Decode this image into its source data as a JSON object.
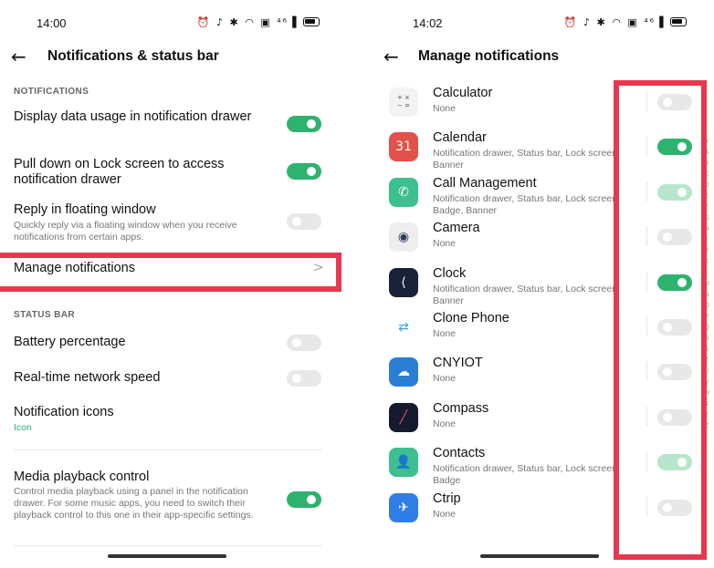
{
  "left": {
    "status_time": "14:00",
    "status_icons": "⏰ ♪ ✱ ◠ ▣ ⁴⁶▐",
    "title": "Notifications & status bar",
    "sections": {
      "notifications_label": "NOTIFICATIONS",
      "status_bar_label": "STATUS BAR"
    },
    "rows": {
      "display_data_usage": {
        "title": "Display data usage in notification drawer",
        "toggle": "on"
      },
      "pull_down_lock": {
        "title": "Pull down on Lock screen to access notification drawer",
        "toggle": "on"
      },
      "reply_floating": {
        "title": "Reply in floating window",
        "subtitle": "Quickly reply via a floating window when you receive notifications from certain apps.",
        "toggle": "off"
      },
      "manage_notifications": {
        "title": "Manage notifications",
        "chevron": ">"
      },
      "battery_percentage": {
        "title": "Battery percentage",
        "toggle": "off"
      },
      "network_speed": {
        "title": "Real-time network speed",
        "toggle": "off"
      },
      "notification_icons": {
        "title": "Notification icons",
        "subtitle": "Icon"
      },
      "media_playback": {
        "title": "Media playback control",
        "subtitle": "Control media playback using a panel in the notification drawer. For some music apps, you need to switch their playback control to this one in their app-specific settings.",
        "toggle": "on"
      }
    }
  },
  "right": {
    "status_time": "14:02",
    "status_icons": "⏰ ♪ ✱ ◠ ▣ ⁴⁶▐",
    "title": "Manage notifications",
    "apps": [
      {
        "name": "Calculator",
        "sub": "None",
        "icon": "calculator-icon",
        "glyph": "+ ×\n− =",
        "bg": "#f3f3f3",
        "fg": "#444",
        "toggle": "off"
      },
      {
        "name": "Calendar",
        "sub": "Notification drawer, Status bar, Lock screen, Banner",
        "icon": "calendar-icon",
        "glyph": "31",
        "bg": "#e2524a",
        "fg": "#ffffff",
        "toggle": "on"
      },
      {
        "name": "Call Management",
        "sub": "Notification drawer, Status bar, Lock screen, Badge, Banner",
        "icon": "phone-icon",
        "glyph": "✆",
        "bg": "#3dbf8f",
        "fg": "#ffffff",
        "toggle": "on-dim"
      },
      {
        "name": "Camera",
        "sub": "None",
        "icon": "camera-icon",
        "glyph": "◉",
        "bg": "#eeeeee",
        "fg": "#2b3e63",
        "toggle": "off"
      },
      {
        "name": "Clock",
        "sub": "Notification drawer, Status bar, Lock screen, Banner",
        "icon": "clock-icon",
        "glyph": "⟨",
        "bg": "#182238",
        "fg": "#ffffff",
        "toggle": "on"
      },
      {
        "name": "Clone Phone",
        "sub": "None",
        "icon": "clone-phone-icon",
        "glyph": "⇄",
        "bg": "#ffffff",
        "fg": "#35a3e8",
        "toggle": "off"
      },
      {
        "name": "CNYIOT",
        "sub": "None",
        "icon": "cnyiot-icon",
        "glyph": "☁",
        "bg": "#2a7fd4",
        "fg": "#ffffff",
        "toggle": "off"
      },
      {
        "name": "Compass",
        "sub": "None",
        "icon": "compass-icon",
        "glyph": "╱",
        "bg": "#161a2e",
        "fg": "#e0506a",
        "toggle": "off"
      },
      {
        "name": "Contacts",
        "sub": "Notification drawer, Status bar, Lock screen, Badge",
        "icon": "contacts-icon",
        "glyph": "👤",
        "bg": "#3dbf8f",
        "fg": "#ffffff",
        "toggle": "on-dim"
      },
      {
        "name": "Ctrip",
        "sub": "None",
        "icon": "ctrip-icon",
        "glyph": "✈",
        "bg": "#2f7ee8",
        "fg": "#ffffff",
        "toggle": "off"
      }
    ]
  },
  "colors": {
    "accent_green": "#2db36e",
    "highlight_red": "#e8384f"
  }
}
